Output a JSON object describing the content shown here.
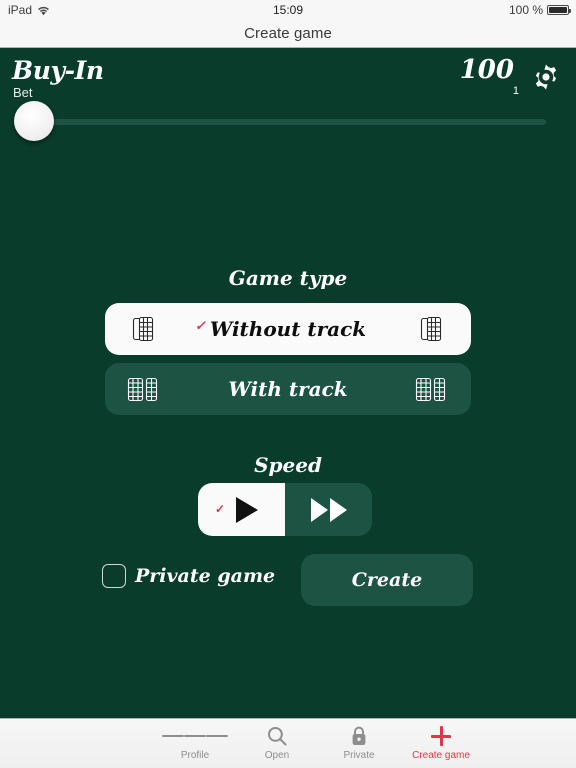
{
  "status_bar": {
    "device": "iPad",
    "wifi_icon": "wifi-icon",
    "time": "15:09",
    "battery_percent": "100 %",
    "battery_icon": "battery-icon"
  },
  "nav_bar": {
    "title": "Create game"
  },
  "buyin": {
    "title": "Buy-In",
    "subtitle": "Bet",
    "amount": "100",
    "multiplier": "1",
    "settings_icon": "gear-icon",
    "slider": {
      "value": 0,
      "min": 0,
      "max": 100
    }
  },
  "game_type": {
    "title": "Game type",
    "options": [
      {
        "label": "Without track",
        "selected": true,
        "icon": "domino-single-icon",
        "check": "✓"
      },
      {
        "label": "With track",
        "selected": false,
        "icon": "domino-double-icon",
        "check": ""
      }
    ]
  },
  "speed": {
    "title": "Speed",
    "options": [
      {
        "name": "normal-speed",
        "icon": "play-icon",
        "selected": true,
        "check": "✓"
      },
      {
        "name": "fast-speed",
        "icon": "fast-forward-icon",
        "selected": false,
        "check": ""
      }
    ]
  },
  "private_game": {
    "label": "Private game",
    "checked": false
  },
  "create_button": {
    "label": "Create"
  },
  "tab_bar": {
    "items": [
      {
        "label": "Profile",
        "icon": "hamburger-icon",
        "active": false
      },
      {
        "label": "Open",
        "icon": "search-icon",
        "active": false
      },
      {
        "label": "Private",
        "icon": "lock-icon",
        "active": false
      },
      {
        "label": "Create game",
        "icon": "plus-icon",
        "active": true
      }
    ]
  },
  "colors": {
    "background": "#0a3c2b",
    "card": "#1d5343",
    "selected_card": "#fafafa",
    "accent_red": "#e8324a",
    "chrome": "#f7f7f7"
  }
}
